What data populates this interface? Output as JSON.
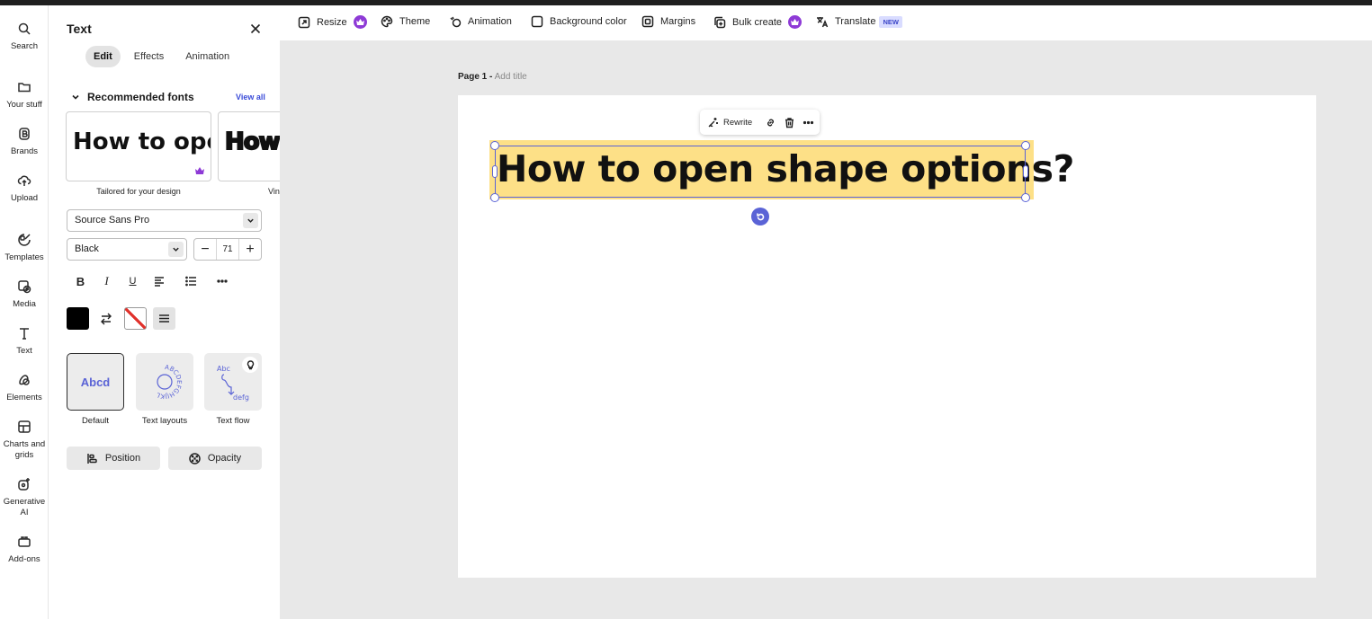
{
  "rail": {
    "items": [
      {
        "label": "Search",
        "icon": "search-icon"
      },
      {
        "label": "Your stuff",
        "icon": "folder-icon"
      },
      {
        "label": "Brands",
        "icon": "brand-icon"
      },
      {
        "label": "Upload",
        "icon": "upload-icon"
      },
      {
        "label": "Templates",
        "icon": "templates-icon"
      },
      {
        "label": "Media",
        "icon": "media-icon"
      },
      {
        "label": "Text",
        "icon": "text-icon"
      },
      {
        "label": "Elements",
        "icon": "elements-icon"
      },
      {
        "label": "Charts and grids",
        "icon": "charts-icon"
      },
      {
        "label": "Generative AI",
        "icon": "generative-ai-icon"
      },
      {
        "label": "Add-ons",
        "icon": "addons-icon"
      }
    ]
  },
  "panel": {
    "title": "Text",
    "tabs": [
      "Edit",
      "Effects",
      "Animation"
    ],
    "active_tab": "Edit",
    "recommended_label": "Recommended fonts",
    "view_all": "View all",
    "font_cards": [
      {
        "sample": "How to open",
        "label": "Tailored for your design"
      },
      {
        "sample": "How",
        "label": "Vin"
      }
    ],
    "font_family": "Source Sans Pro",
    "font_weight": "Black",
    "font_size": "71",
    "text_color": "#000000",
    "styles": [
      {
        "preview": "Abcd",
        "label": "Default"
      },
      {
        "preview": "ABCDEFGHIJKL",
        "label": "Text layouts"
      },
      {
        "preview_top": "Abc",
        "preview_bottom": "defg",
        "label": "Text flow"
      }
    ],
    "position_label": "Position",
    "opacity_label": "Opacity"
  },
  "toolbar": {
    "resize": "Resize",
    "theme": "Theme",
    "animation": "Animation",
    "background_color": "Background color",
    "margins": "Margins",
    "bulk_create": "Bulk create",
    "translate": "Translate",
    "new_badge": "NEW"
  },
  "canvas": {
    "page_label": "Page 1 -",
    "add_title": "Add title",
    "rewrite": "Rewrite",
    "text": "How to open shape options?",
    "highlight_color": "#fde087",
    "selection_color": "#5a63d6"
  }
}
